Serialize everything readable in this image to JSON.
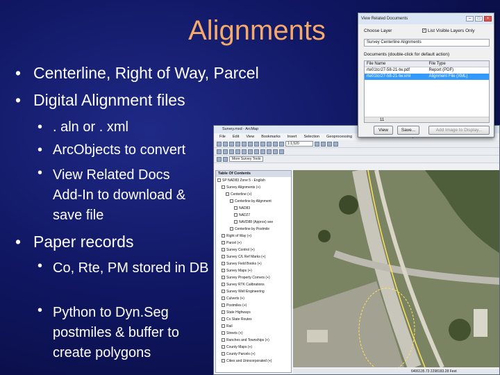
{
  "slide": {
    "title": "Alignments",
    "bullets": [
      {
        "text": "Centerline, Right of Way, Parcel"
      },
      {
        "text": "Digital Alignment files"
      }
    ],
    "sub_bullets_1": [
      {
        "text": ". aln or . xml"
      },
      {
        "text": "ArcObjects to convert"
      },
      {
        "text": "View Related Docs Add-In to download & save file"
      }
    ],
    "bullet3": {
      "text": "Paper records"
    },
    "sub_bullets_2": [
      {
        "text": "Co, Rte, PM stored in DB"
      },
      {
        "text": "Python to Dyn.Seg postmiles & buffer to create polygons"
      }
    ],
    "bullet_glyph": "•"
  },
  "related_docs": {
    "title": "View Related Documents",
    "choose_layer_label": "Choose Layer",
    "visible_layers_label": "List Visible Layers Only",
    "layer_value": "Survey Centerline Alignments",
    "documents_label": "Documents (double-click for default action)",
    "columns": [
      "File Name",
      "File Type"
    ],
    "rows": [
      [
        "rte01tcr27-58-21-tw.pdf",
        "Report (PDF)"
      ],
      [
        "rte01tcr27-58-21-tw.xml",
        "Alignment File (XML)"
      ]
    ],
    "scroll_value": "11",
    "buttons": {
      "view": "View",
      "save": "Save...",
      "add": "Add Image to Display..."
    }
  },
  "arcmap": {
    "title": "Survey.mxd - ArcMap",
    "menu": [
      "File",
      "Edit",
      "View",
      "Bookmarks",
      "Insert",
      "Selection",
      "Geoprocessing",
      "Customize",
      "Windows",
      "Help"
    ],
    "scale": "1:1,520",
    "toolbar_label": "More Survey Tools",
    "toc_title": "Table Of Contents",
    "toc_items": [
      "SP NAD83 Zone 5 - English",
      "Survey Alignments (+)",
      "Centerline (+)",
      "Centerline by Alignment",
      "NAD83",
      "NAD27",
      "NAVD88 (Approx) see",
      "Centerline by Postmile",
      "Right of Way (+)",
      "Parcel (+)",
      "Survey Control (+)",
      "Survey C/L Ref Marks (+)",
      "Survey Field Books (+)",
      "Survey Maps (+)",
      "Survey Property Corners (+)",
      "Survey RTK Calibrations",
      "Survey Well Engineering",
      "Culverts (+)",
      "Postmiles (+)",
      "State Highways",
      "Co State Routes",
      "Rail",
      "Streets (+)",
      "Ranches and Townships (+)",
      "County Maps (+)",
      "County Parcels (+)",
      "Cities and Unincorporated (+)"
    ],
    "status_text": "6406135.73 2298183.28 Feet"
  }
}
